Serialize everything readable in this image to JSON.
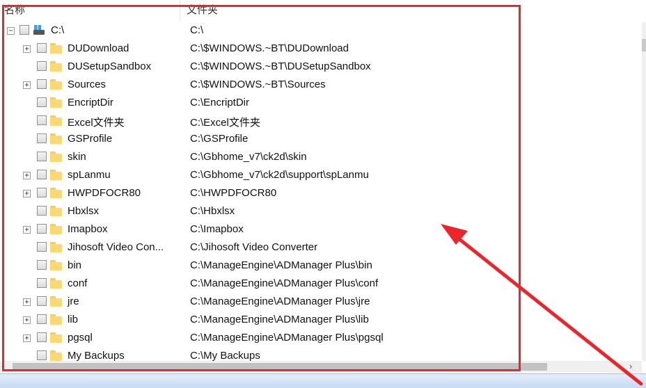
{
  "header": {
    "col_name": "名称",
    "col_folder": "文件夹"
  },
  "tree": {
    "root": {
      "name": "C:\\",
      "path": "C:\\",
      "expander": "⊟"
    },
    "rows": [
      {
        "name": "DUDownload",
        "path": "C:\\$WINDOWS.~BT\\DUDownload",
        "expandable": true
      },
      {
        "name": "DUSetupSandbox",
        "path": "C:\\$WINDOWS.~BT\\DUSetupSandbox",
        "expandable": false
      },
      {
        "name": "Sources",
        "path": "C:\\$WINDOWS.~BT\\Sources",
        "expandable": true
      },
      {
        "name": "EncriptDir",
        "path": "C:\\EncriptDir",
        "expandable": false
      },
      {
        "name": "Excel文件夹",
        "path": "C:\\Excel文件夹",
        "expandable": false
      },
      {
        "name": "GSProfile",
        "path": "C:\\GSProfile",
        "expandable": false
      },
      {
        "name": "skin",
        "path": "C:\\Gbhome_v7\\ck2d\\skin",
        "expandable": false
      },
      {
        "name": "spLanmu",
        "path": "C:\\Gbhome_v7\\ck2d\\support\\spLanmu",
        "expandable": true
      },
      {
        "name": "HWPDFOCR80",
        "path": "C:\\HWPDFOCR80",
        "expandable": true
      },
      {
        "name": "Hbxlsx",
        "path": "C:\\Hbxlsx",
        "expandable": false
      },
      {
        "name": "Imapbox",
        "path": "C:\\Imapbox",
        "expandable": true
      },
      {
        "name": "Jihosoft Video Con...",
        "path": "C:\\Jihosoft Video Converter",
        "expandable": false
      },
      {
        "name": "bin",
        "path": "C:\\ManageEngine\\ADManager Plus\\bin",
        "expandable": false
      },
      {
        "name": "conf",
        "path": "C:\\ManageEngine\\ADManager Plus\\conf",
        "expandable": false
      },
      {
        "name": "jre",
        "path": "C:\\ManageEngine\\ADManager Plus\\jre",
        "expandable": true
      },
      {
        "name": "lib",
        "path": "C:\\ManageEngine\\ADManager Plus\\lib",
        "expandable": true
      },
      {
        "name": "pgsql",
        "path": "C:\\ManageEngine\\ADManager Plus\\pgsql",
        "expandable": true
      },
      {
        "name": "My Backups",
        "path": "C:\\My Backups",
        "expandable": false
      }
    ],
    "expand_glyph": "+"
  },
  "scrollbar": {
    "left_arrow": "‹",
    "right_arrow": "›"
  },
  "colors": {
    "highlight_box": "#e8262b",
    "folder": "#fbd876"
  }
}
